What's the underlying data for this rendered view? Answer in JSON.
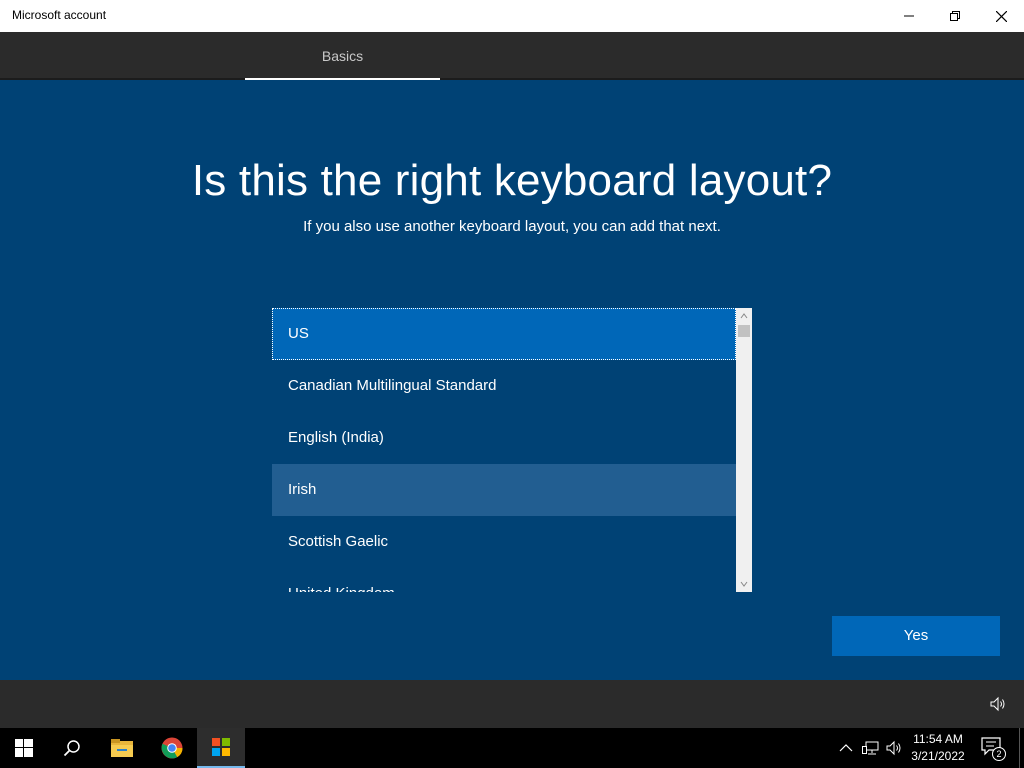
{
  "window": {
    "title": "Microsoft account"
  },
  "nav": {
    "active_tab": "Basics"
  },
  "main": {
    "heading": "Is this the right keyboard layout?",
    "subheading": "If you also use another keyboard layout, you can add that next.",
    "layouts": [
      "US",
      "Canadian Multilingual Standard",
      "English (India)",
      "Irish",
      "Scottish Gaelic",
      "United Kingdom"
    ],
    "selected_layout": "US",
    "hovered_layout": "Irish",
    "yes_label": "Yes"
  },
  "taskbar": {
    "time": "11:54 AM",
    "date": "3/21/2022",
    "notification_count": "2"
  },
  "colors": {
    "background": "#004275",
    "accent": "#0067b8",
    "hover": "#225e91",
    "navbar": "#2b2b2b",
    "taskbar": "#000000"
  },
  "icons": {
    "window_controls": [
      "minimize-icon",
      "restore-icon",
      "close-icon"
    ],
    "taskbar": [
      "windows-start-icon",
      "search-icon",
      "file-explorer-icon",
      "chrome-icon",
      "microsoft-store-icon"
    ],
    "tray": [
      "chevron-up-icon",
      "network-icon",
      "volume-icon",
      "notification-icon"
    ]
  }
}
